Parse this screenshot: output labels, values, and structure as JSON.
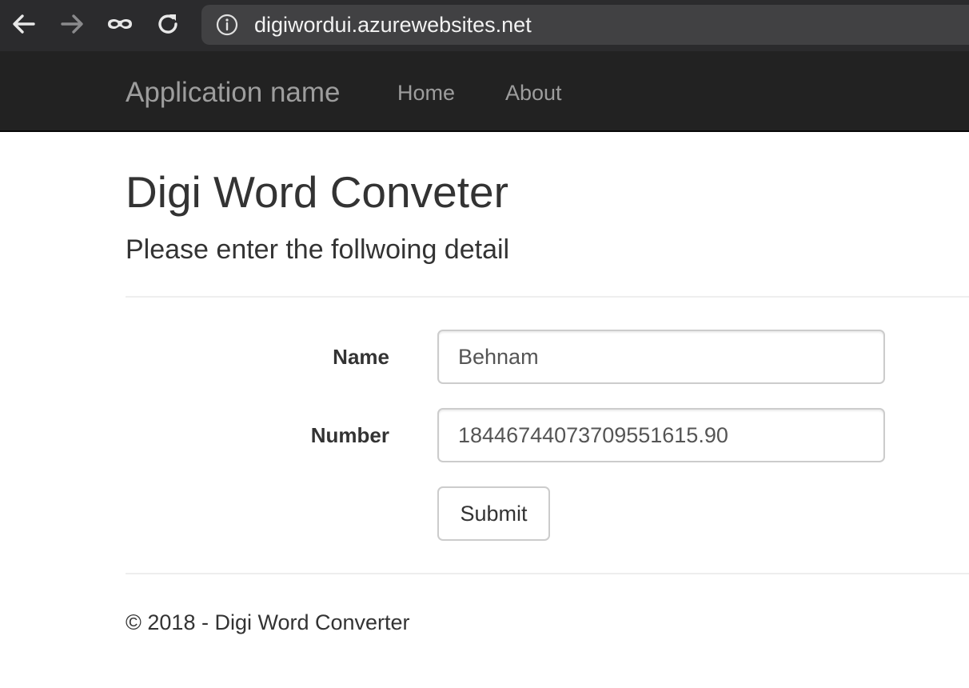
{
  "browser": {
    "url": "digiwordui.azurewebsites.net",
    "icons": {
      "back": "arrow-left-icon",
      "forward": "arrow-right-icon",
      "incognito": "incognito-mask-icon",
      "reload": "reload-icon",
      "site_info": "info-circle-icon"
    }
  },
  "navbar": {
    "brand": "Application name",
    "links": [
      {
        "label": "Home"
      },
      {
        "label": "About"
      }
    ]
  },
  "main": {
    "title": "Digi Word Conveter",
    "subtitle": "Please enter the follwoing detail",
    "form": {
      "name_label": "Name",
      "name_value": "Behnam",
      "number_label": "Number",
      "number_value": "18446744073709551615.90",
      "submit_label": "Submit"
    }
  },
  "footer": {
    "text": "© 2018 - Digi Word Converter"
  },
  "colors": {
    "browser_chrome": "#2b2b2d",
    "address_bar": "#414143",
    "navbar_background": "#222222",
    "navbar_text": "#9d9d9d",
    "body_text": "#333333"
  }
}
